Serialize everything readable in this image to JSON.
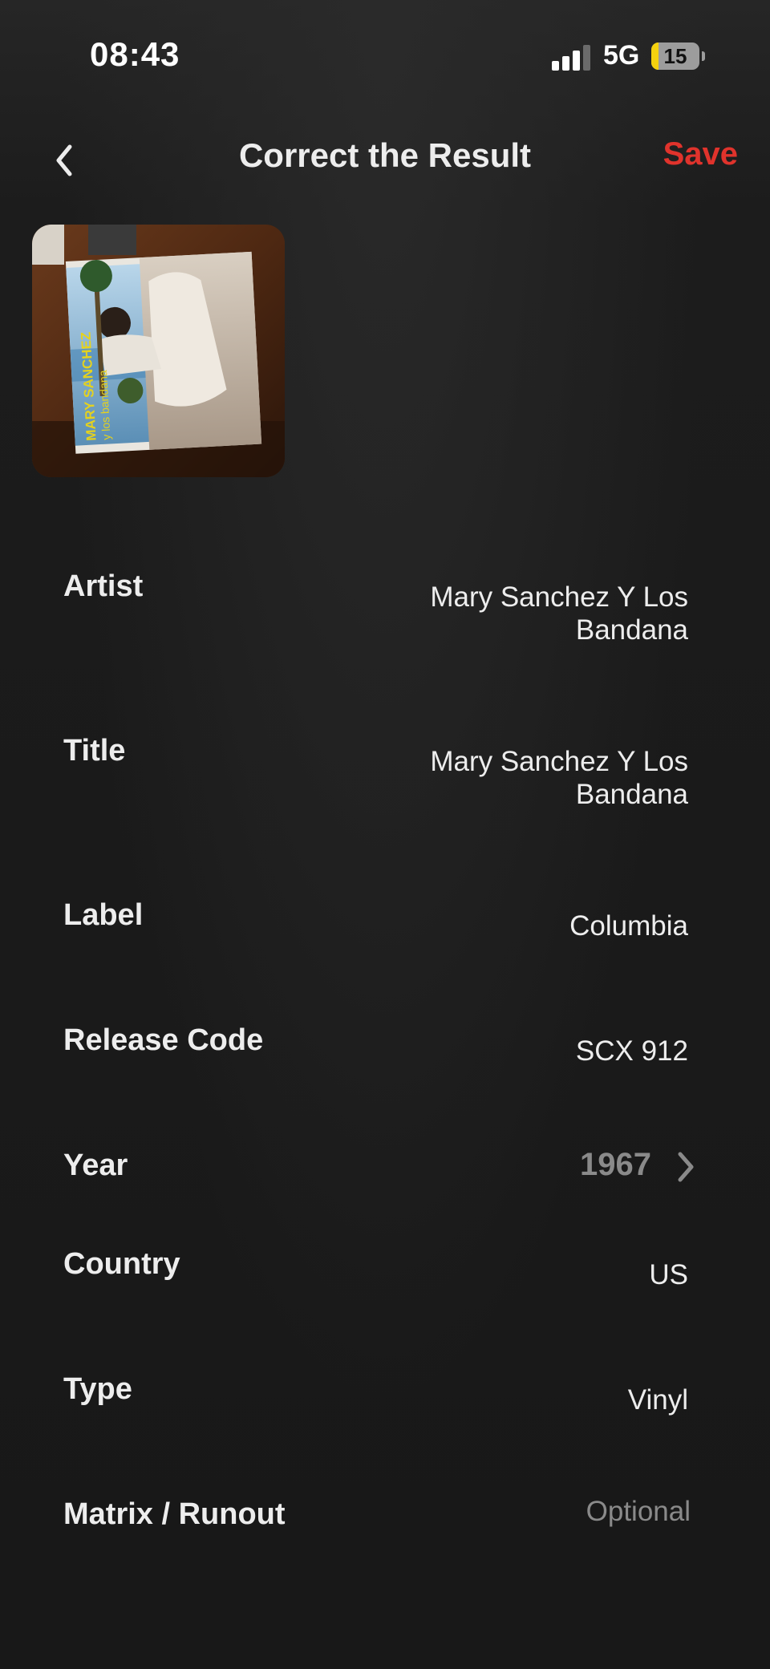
{
  "status_bar": {
    "time": "08:43",
    "network": "5G",
    "battery_percent": "15",
    "battery_level": 0.15,
    "signal_bars_active": 3,
    "signal_bars_total": 4
  },
  "header": {
    "title": "Correct the Result",
    "save_label": "Save",
    "back_icon": "chevron-left-icon"
  },
  "cover": {
    "title_text": "MARY SANCHEZ",
    "subtitle_text": "y los bandana"
  },
  "fields": [
    {
      "label": "Artist",
      "value": "Mary Sanchez Y Los Bandana"
    },
    {
      "label": "Title",
      "value": "Mary Sanchez Y Los Bandana"
    },
    {
      "label": "Label",
      "value": "Columbia"
    },
    {
      "label": "Release Code",
      "value": "SCX 912"
    },
    {
      "label": "Year",
      "value": "1967"
    },
    {
      "label": "Country",
      "value": "US"
    },
    {
      "label": "Type",
      "value": "Vinyl"
    },
    {
      "label": "Matrix / Runout",
      "placeholder": "Optional"
    }
  ],
  "colors": {
    "accent": "#e0332c",
    "background": "#1a1a1a",
    "text": "#ededed",
    "muted": "#8a8a8a",
    "battery": "#f5d10f"
  }
}
